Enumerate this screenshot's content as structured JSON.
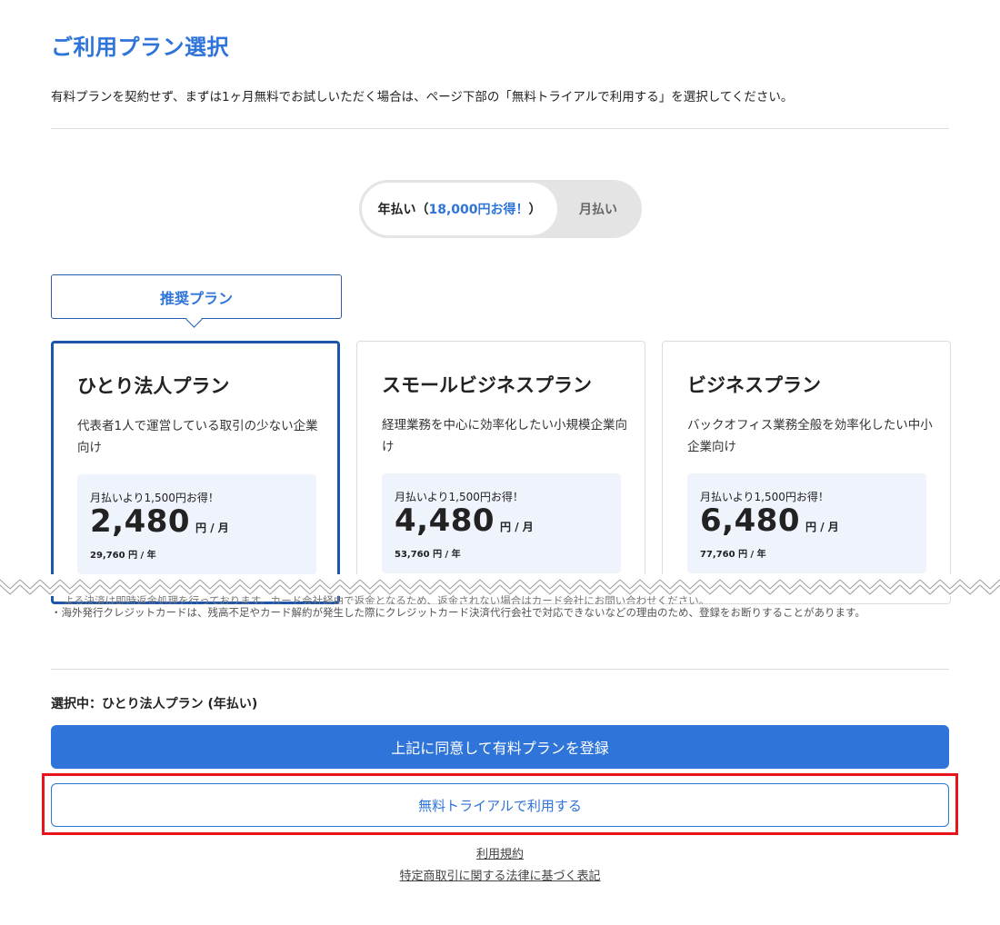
{
  "page": {
    "title": "ご利用プラン選択",
    "intro": "有料プランを契約せず、まずは1ヶ月無料でお試しいただく場合は、ページ下部の「無料トライアルで利用する」を選択してください。"
  },
  "billing_toggle": {
    "annual_label": "年払い（",
    "annual_save": "18,000円お得！",
    "annual_close": "）",
    "monthly_label": "月払い",
    "selected": "annual"
  },
  "recommended_label": "推奨プラン",
  "plans": [
    {
      "name": "ひとり法人プラン",
      "description": "代表者1人で運営している取引の少ない企業向け",
      "savings_note": "月払いより1,500円お得！",
      "price": "2,480",
      "price_unit": "円 / 月",
      "annual_price": "29,760 円 / 年",
      "selected": true
    },
    {
      "name": "スモールビジネスプラン",
      "description": "経理業務を中心に効率化したい小規模企業向け",
      "savings_note": "月払いより1,500円お得！",
      "price": "4,480",
      "price_unit": "円 / 月",
      "annual_price": "53,760 円 / 年",
      "selected": false
    },
    {
      "name": "ビジネスプラン",
      "description": "バックオフィス業務全般を効率化したい中小企業向け",
      "savings_note": "月払いより1,500円お得！",
      "price": "6,480",
      "price_unit": "円 / 月",
      "annual_price": "77,760 円 / 年",
      "selected": false
    }
  ],
  "notes": {
    "line1": "よる決済は即時返金処理を行っております。カード会社経由で返金となるため、返金されない場合はカード会社にお問い合わせください。",
    "line2": "・海外発行クレジットカードは、残高不足やカード解約が発生した際にクレジットカード決済代行会社で対応できないなどの理由のため、登録をお断りすることがあります。"
  },
  "selection": {
    "label": "選択中：",
    "value": "ひとり法人プラン (年払い)"
  },
  "buttons": {
    "register": "上記に同意して有料プランを登録",
    "free_trial": "無料トライアルで利用する"
  },
  "links": {
    "terms": "利用規約",
    "commercial_law": "特定商取引に関する法律に基づく表記"
  },
  "colors": {
    "accent": "#2f74d8",
    "selected_border": "#1e56aa",
    "highlight": "#e8141c",
    "price_box_bg": "#eff3fc"
  }
}
